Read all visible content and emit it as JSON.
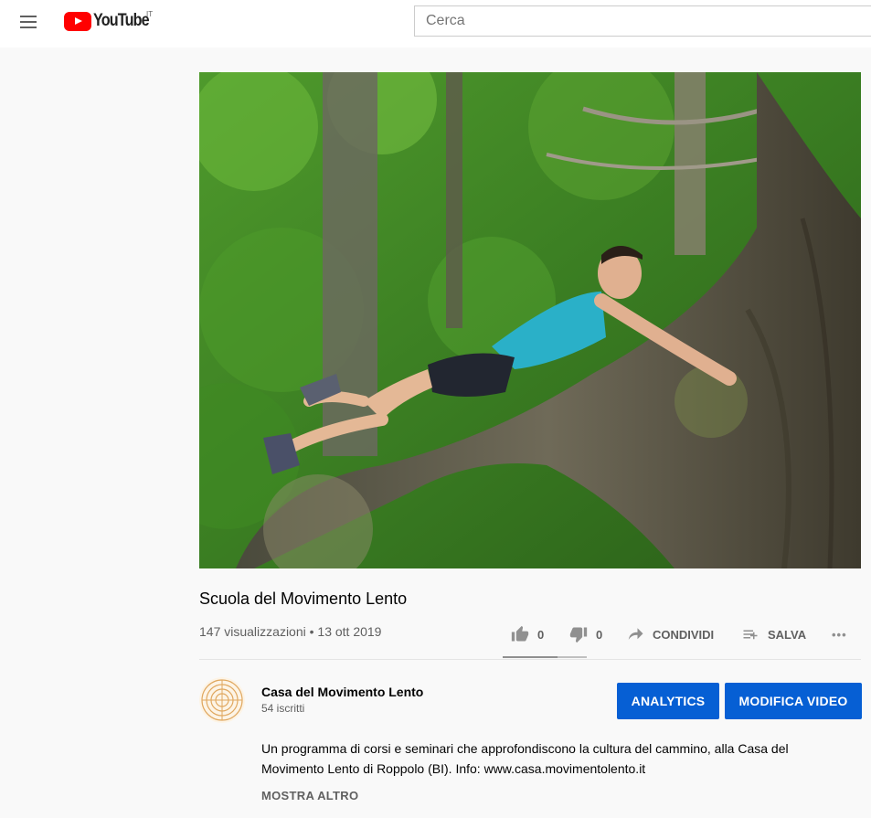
{
  "header": {
    "logo_text": "YouTube",
    "country_code": "IT",
    "search_placeholder": "Cerca"
  },
  "video": {
    "title": "Scuola del Movimento Lento",
    "meta": "147 visualizzazioni • 13 ott 2019"
  },
  "actions": {
    "likes": "0",
    "dislikes": "0",
    "share_label": "CONDIVIDI",
    "save_label": "SALVA",
    "more_label": "•••"
  },
  "channel": {
    "name": "Casa del Movimento Lento",
    "subscribers": "54 iscritti",
    "analytics_label": "ANALYTICS",
    "edit_label": "MODIFICA VIDEO"
  },
  "description": {
    "text": "Un programma di corsi e seminari che approfondiscono la cultura del cammino, alla Casa del Movimento Lento di Roppolo (BI). Info: www.casa.movimentolento.it",
    "show_more_label": "MOSTRA ALTRO"
  },
  "colors": {
    "accent": "#065fd4",
    "brand": "#ff0000"
  }
}
